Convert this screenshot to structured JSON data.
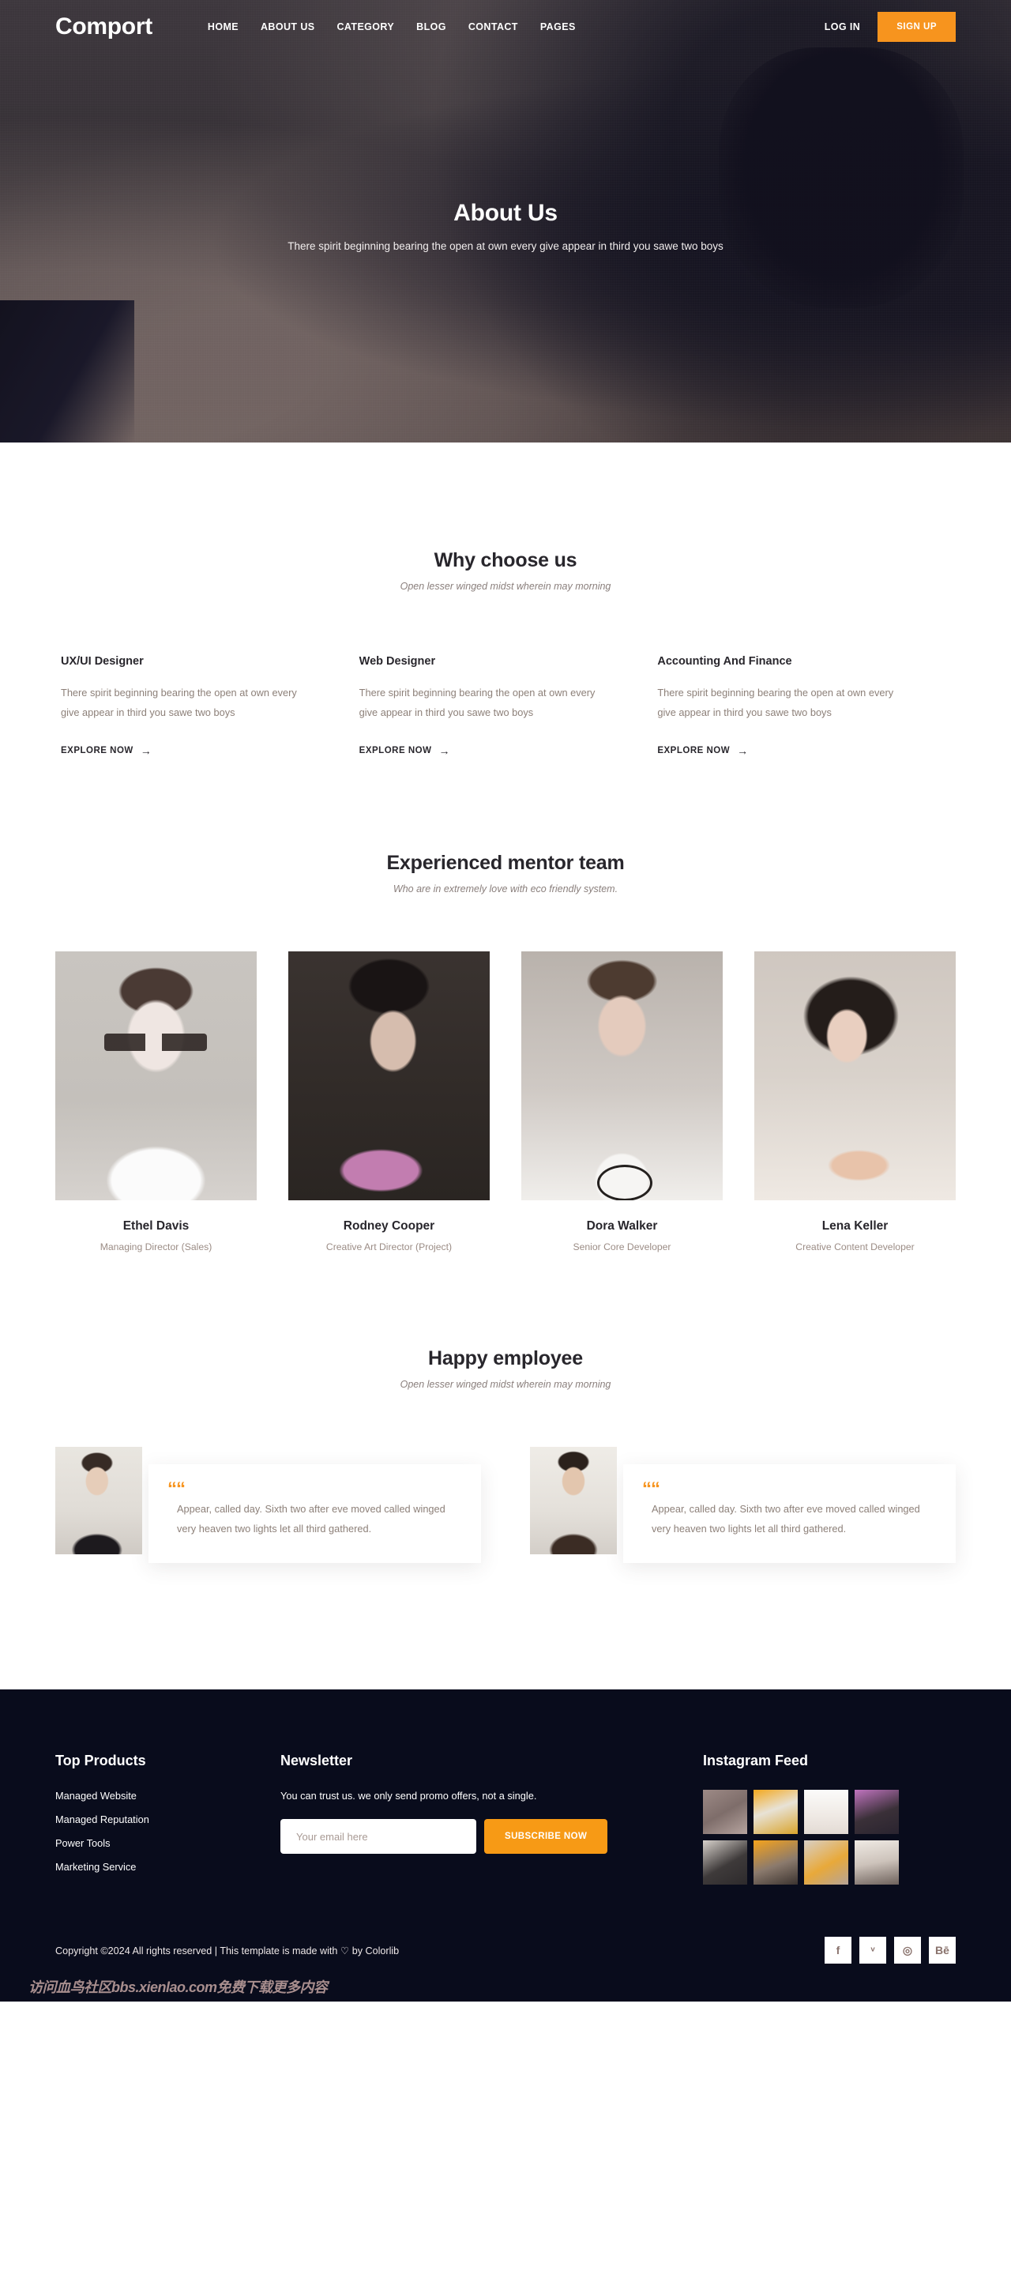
{
  "brand": {
    "name": "Comport",
    "accent": "#f7941e",
    "dark": "#090c1c"
  },
  "nav": {
    "items": [
      {
        "label": "HOME"
      },
      {
        "label": "ABOUT US"
      },
      {
        "label": "CATEGORY"
      },
      {
        "label": "BLOG"
      },
      {
        "label": "CONTACT"
      },
      {
        "label": "PAGES"
      }
    ],
    "login_label": "LOG IN",
    "signup_label": "SIGN UP"
  },
  "hero": {
    "title": "About Us",
    "subtitle": "There spirit beginning bearing the open at own every give appear in third you sawe two boys"
  },
  "why": {
    "title": "Why choose us",
    "subtitle": "Open lesser winged midst wherein may morning",
    "columns": [
      {
        "title": "UX/UI Designer",
        "text": "There spirit beginning bearing the open at own every give appear in third you sawe two boys",
        "cta": "EXPLORE NOW",
        "arrow": "→"
      },
      {
        "title": "Web Designer",
        "text": "There spirit beginning bearing the open at own every give appear in third you sawe two boys",
        "cta": "EXPLORE NOW",
        "arrow": "→"
      },
      {
        "title": "Accounting And Finance",
        "text": "There spirit beginning bearing the open at own every give appear in third you sawe two boys",
        "cta": "EXPLORE NOW",
        "arrow": "→"
      }
    ]
  },
  "team": {
    "title": "Experienced mentor team",
    "subtitle": "Who are in extremely love with eco friendly system.",
    "members": [
      {
        "name": "Ethel Davis",
        "role": "Managing Director (Sales)",
        "photo": "team-photo-ethel-davis"
      },
      {
        "name": "Rodney Cooper",
        "role": "Creative Art Director (Project)",
        "photo": "team-photo-rodney-cooper"
      },
      {
        "name": "Dora Walker",
        "role": "Senior Core Developer",
        "photo": "team-photo-dora-walker"
      },
      {
        "name": "Lena Keller",
        "role": "Creative Content Developer",
        "photo": "team-photo-lena-keller"
      }
    ]
  },
  "testimonials": {
    "title": "Happy employee",
    "subtitle": "Open lesser winged midst wherein may morning",
    "quote_icon": "““",
    "items": [
      {
        "text": "Appear, called day. Sixth two after eve moved called winged very heaven two lights let all third gathered.",
        "photo": "testimonial-photo-1"
      },
      {
        "text": "Appear, called day. Sixth two after eve moved called winged very heaven two lights let all third gathered.",
        "photo": "testimonial-photo-2"
      }
    ]
  },
  "footer": {
    "products": {
      "title": "Top Products",
      "links": [
        {
          "label": "Managed Website"
        },
        {
          "label": "Managed Reputation"
        },
        {
          "label": "Power Tools"
        },
        {
          "label": "Marketing Service"
        }
      ]
    },
    "newsletter": {
      "title": "Newsletter",
      "text": "You can trust us. we only send promo offers, not a single.",
      "placeholder": "Your email here",
      "value": "",
      "button": "SUBSCRIBE NOW"
    },
    "instagram": {
      "title": "Instagram Feed",
      "cells": [
        {
          "name": "instagram-thumb-1"
        },
        {
          "name": "instagram-thumb-2"
        },
        {
          "name": "instagram-thumb-3"
        },
        {
          "name": "instagram-thumb-4"
        },
        {
          "name": "instagram-thumb-5"
        },
        {
          "name": "instagram-thumb-6"
        },
        {
          "name": "instagram-thumb-7"
        },
        {
          "name": "instagram-thumb-8"
        }
      ]
    },
    "copyright": "Copyright ©2024 All rights reserved | This template is made with ♡ by Colorlib",
    "socials": [
      {
        "name": "facebook-icon",
        "glyph": "f"
      },
      {
        "name": "twitter-icon",
        "glyph": "ᵛ"
      },
      {
        "name": "dribbble-icon",
        "glyph": "◎"
      },
      {
        "name": "behance-icon",
        "glyph": "Bē"
      }
    ],
    "watermark": "访问血鸟社区bbs.xienlao.com免费下载更多内容"
  }
}
